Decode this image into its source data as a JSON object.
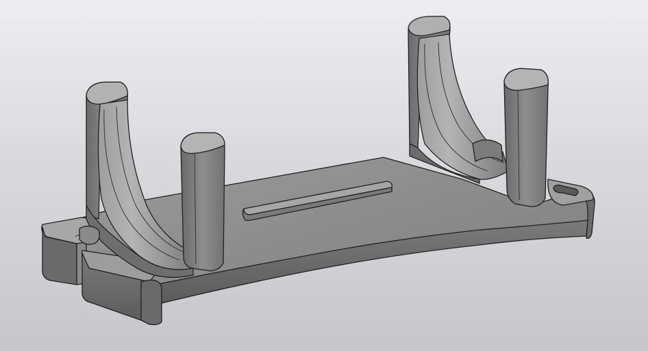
{
  "viewport": {
    "background_top": "#ededf2",
    "background_bottom": "#c6c6cb"
  },
  "model": {
    "colors": {
      "top_face": "#8c8c8c",
      "side_face": "#6f6f6f",
      "light_face": "#a3a3a3",
      "dark_face": "#5d5d5d",
      "edge": "#202020"
    }
  }
}
